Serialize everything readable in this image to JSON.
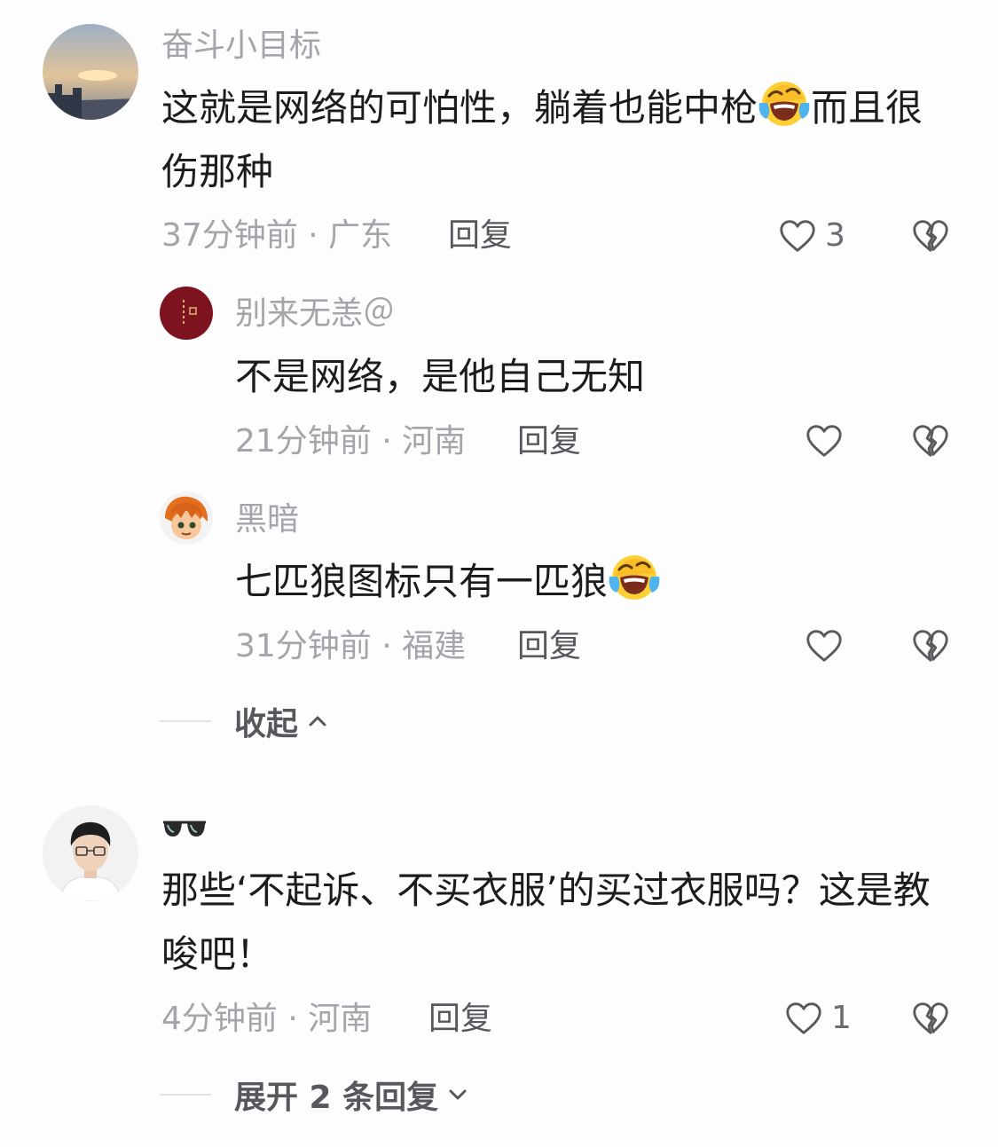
{
  "comments": [
    {
      "username": "奋斗小目标",
      "text_1": "这就是网络的可怕性，躺着也能中枪",
      "text_2": "而且很伤那种",
      "time": "37分钟前 · 广东",
      "reply_label": "回复",
      "like_count": "3",
      "emoji": "laughing-crying-emoji"
    },
    {
      "username": "🕶",
      "text": "那些‘不起诉、不买衣服’的买过衣服吗？这是教唆吧！",
      "time": "4分钟前 · 河南",
      "reply_label": "回复",
      "like_count": "1",
      "emoji": "sunglasses-emoji"
    }
  ],
  "replies": [
    {
      "username": "别来无恙＠",
      "text": "不是网络，是他自己无知",
      "time": "21分钟前 · 河南",
      "reply_label": "回复"
    },
    {
      "username": "黑暗",
      "text": "七匹狼图标只有一匹狼",
      "time": "31分钟前 · 福建",
      "reply_label": "回复",
      "emoji": "laughing-crying-emoji"
    }
  ],
  "collapse_label": "收起",
  "expand_label": "展开 2 条回复",
  "colors": {
    "secondary": "#a4a4aa",
    "text": "#1c1c1e",
    "reply": "#57575d",
    "background": "#fdfdfd"
  }
}
